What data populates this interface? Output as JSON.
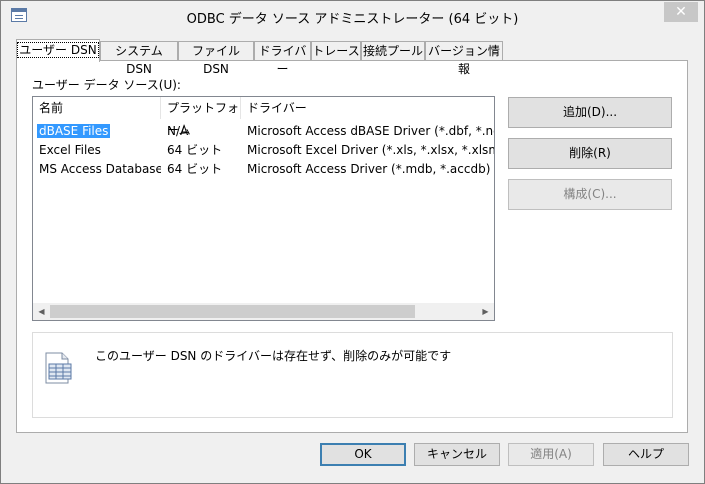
{
  "window": {
    "title": "ODBC データ ソース アドミニストレーター (64 ビット)",
    "close_glyph": "✕"
  },
  "tabs": [
    {
      "label": "ユーザー DSN",
      "active": true
    },
    {
      "label": "システム DSN"
    },
    {
      "label": "ファイル DSN"
    },
    {
      "label": "ドライバー"
    },
    {
      "label": "トレース"
    },
    {
      "label": "接続プール"
    },
    {
      "label": "バージョン情報"
    }
  ],
  "user_dsn": {
    "section_label": "ユーザー データ ソース(U):",
    "columns": [
      "名前",
      "プラットフォーム",
      "ドライバー"
    ],
    "rows": [
      {
        "name": "dBASE Files",
        "platform": "N/A",
        "driver": "Microsoft Access dBASE Driver (*.dbf, *.ndx, *.mdx)",
        "selected": true
      },
      {
        "name": "Excel Files",
        "platform": "64 ビット",
        "driver": "Microsoft Excel Driver (*.xls, *.xlsx, *.xlsm, *.xlsb)"
      },
      {
        "name": "MS Access Database",
        "platform": "64 ビット",
        "driver": "Microsoft Access Driver (*.mdb, *.accdb)"
      }
    ],
    "buttons": {
      "add": "追加(D)...",
      "remove": "削除(R)",
      "configure": "構成(C)..."
    },
    "info_text": "このユーザー DSN のドライバーは存在せず、削除のみが可能です"
  },
  "dialog_buttons": {
    "ok": "OK",
    "cancel": "キャンセル",
    "apply": "適用(A)",
    "help": "ヘルプ"
  },
  "colors": {
    "selection": "#3399ff",
    "default_button_border": "#3c7fb1"
  }
}
